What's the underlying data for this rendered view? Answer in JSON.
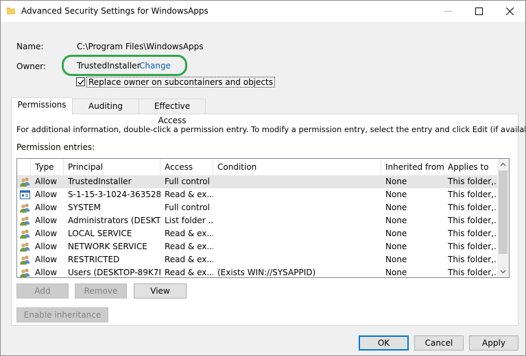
{
  "window": {
    "title": "Advanced Security Settings for WindowsApps",
    "minimize_glyph": "—"
  },
  "info": {
    "name_label": "Name:",
    "name_value": "C:\\Program Files\\WindowsApps",
    "owner_label": "Owner:",
    "owner_value": "TrustedInstaller",
    "change_link": "Change",
    "replace_owner_label": "Replace owner on subcontainers and objects",
    "replace_owner_checked": true
  },
  "tabs": [
    {
      "label": "Permissions",
      "active": true
    },
    {
      "label": "Auditing",
      "active": false
    },
    {
      "label": "Effective Access",
      "active": false
    }
  ],
  "panel": {
    "info_text": "For additional information, double-click a permission entry. To modify a permission entry, select the entry and click Edit (if available).",
    "entries_label": "Permission entries:"
  },
  "table": {
    "columns": [
      "Type",
      "Principal",
      "Access",
      "Condition",
      "Inherited from",
      "Applies to"
    ],
    "rows": [
      {
        "icon": "users-icon",
        "type": "Allow",
        "principal": "TrustedInstaller",
        "access": "Full control",
        "condition": "",
        "inherited": "None",
        "applies": "This folder,..."
      },
      {
        "icon": "package-sid-icon",
        "type": "Allow",
        "principal": "S-1-15-3-1024-363528...",
        "access": "Read & ex...",
        "condition": "",
        "inherited": "None",
        "applies": "This folder,..."
      },
      {
        "icon": "users-icon",
        "type": "Allow",
        "principal": "SYSTEM",
        "access": "Full control",
        "condition": "",
        "inherited": "None",
        "applies": "This folder,..."
      },
      {
        "icon": "users-icon",
        "type": "Allow",
        "principal": "Administrators (DESKT...",
        "access": "List folder ...",
        "condition": "",
        "inherited": "None",
        "applies": "This folder,..."
      },
      {
        "icon": "users-icon",
        "type": "Allow",
        "principal": "LOCAL SERVICE",
        "access": "Read & ex...",
        "condition": "",
        "inherited": "None",
        "applies": "This folder,..."
      },
      {
        "icon": "users-icon",
        "type": "Allow",
        "principal": "NETWORK SERVICE",
        "access": "Read & ex...",
        "condition": "",
        "inherited": "None",
        "applies": "This folder,..."
      },
      {
        "icon": "users-icon",
        "type": "Allow",
        "principal": "RESTRICTED",
        "access": "Read & ex...",
        "condition": "",
        "inherited": "None",
        "applies": "This folder,..."
      },
      {
        "icon": "users-icon",
        "type": "Allow",
        "principal": "Users (DESKTOP-89K7F...",
        "access": "Read & ex...",
        "condition": "(Exists WIN://SYSAPPID)",
        "inherited": "None",
        "applies": "This folder,..."
      }
    ]
  },
  "buttons": {
    "add": "Add",
    "remove": "Remove",
    "view": "View",
    "enable_inheritance": "Enable inheritance",
    "ok": "OK",
    "cancel": "Cancel",
    "apply": "Apply"
  },
  "colors": {
    "link": "#0a5eb1",
    "highlight": "#2fa64b",
    "selected_row": "#e5e5e5"
  }
}
